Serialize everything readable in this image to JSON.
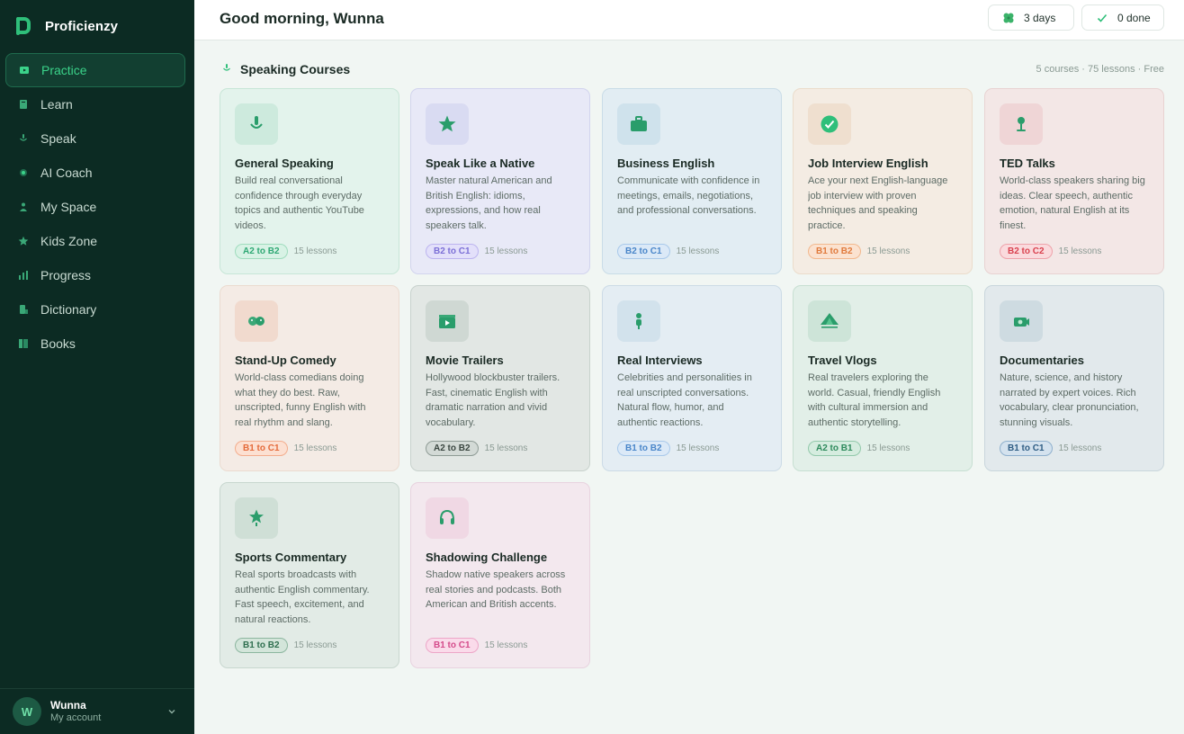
{
  "app": {
    "name": "Proficienzy"
  },
  "nav": [
    {
      "label": "Practice",
      "icon": "practice-icon",
      "active": true
    },
    {
      "label": "Learn",
      "icon": "book-icon"
    },
    {
      "label": "Speak",
      "icon": "mic-icon"
    },
    {
      "label": "AI Coach",
      "icon": "coach-icon"
    },
    {
      "label": "My Space",
      "icon": "person-icon"
    },
    {
      "label": "Kids Zone",
      "icon": "star-icon"
    },
    {
      "label": "Progress",
      "icon": "chart-icon"
    },
    {
      "label": "Dictionary",
      "icon": "dictionary-icon"
    },
    {
      "label": "Books",
      "icon": "books-icon"
    }
  ],
  "account": {
    "initial": "W",
    "name": "Wunna",
    "subtitle": "My account"
  },
  "header": {
    "greeting": "Good morning, Wunna",
    "streak": "3 days",
    "done": "0 done"
  },
  "section": {
    "title": "Speaking Courses",
    "meta": "5 courses · 75 lessons · Free"
  },
  "colors": {
    "brand": "#2fbf7a",
    "sidebar": "#0c2b23"
  },
  "courses": [
    {
      "title": "General Speaking",
      "desc": "Build real conversational confidence through everyday topics and authentic YouTube videos.",
      "level": "A2 to B2",
      "lessons": "15 lessons",
      "icon": "mic-icon"
    },
    {
      "title": "Speak Like a Native",
      "desc": "Master natural American and British English: idioms, expressions, and how real speakers talk.",
      "level": "B2 to C1",
      "lessons": "15 lessons",
      "icon": "star-icon"
    },
    {
      "title": "Business English",
      "desc": "Communicate with confidence in meetings, emails, negotiations, and professional conversations.",
      "level": "B2 to C1",
      "lessons": "15 lessons",
      "icon": "briefcase-icon"
    },
    {
      "title": "Job Interview English",
      "desc": "Ace your next English-language job interview with proven techniques and speaking practice.",
      "level": "B1 to B2",
      "lessons": "15 lessons",
      "icon": "check-circle-icon"
    },
    {
      "title": "TED Talks",
      "desc": "World-class speakers sharing big ideas. Clear speech, authentic emotion, natural English at its finest.",
      "level": "B2 to C2",
      "lessons": "15 lessons",
      "icon": "speaker-icon"
    },
    {
      "title": "Stand-Up Comedy",
      "desc": "World-class comedians doing what they do best. Raw, unscripted, funny English with real rhythm and slang.",
      "level": "B1 to C1",
      "lessons": "15 lessons",
      "icon": "comedy-icon"
    },
    {
      "title": "Movie Trailers",
      "desc": "Hollywood blockbuster trailers. Fast, cinematic English with dramatic narration and vivid vocabulary.",
      "level": "A2 to B2",
      "lessons": "15 lessons",
      "icon": "clapper-icon"
    },
    {
      "title": "Real Interviews",
      "desc": "Celebrities and personalities in real unscripted conversations. Natural flow, humor, and authentic reactions.",
      "level": "B1 to B2",
      "lessons": "15 lessons",
      "icon": "person-mic-icon"
    },
    {
      "title": "Travel Vlogs",
      "desc": "Real travelers exploring the world. Casual, friendly English with cultural immersion and authentic storytelling.",
      "level": "A2 to B1",
      "lessons": "15 lessons",
      "icon": "tent-icon"
    },
    {
      "title": "Documentaries",
      "desc": "Nature, science, and history narrated by expert voices. Rich vocabulary, clear pronunciation, stunning visuals.",
      "level": "B1 to C1",
      "lessons": "15 lessons",
      "icon": "camera-icon"
    },
    {
      "title": "Sports Commentary",
      "desc": "Real sports broadcasts with authentic English commentary. Fast speech, excitement, and natural reactions.",
      "level": "B1 to B2",
      "lessons": "15 lessons",
      "icon": "trophy-icon"
    },
    {
      "title": "Shadowing Challenge",
      "desc": "Shadow native speakers across real stories and podcasts. Both American and British accents.",
      "level": "B1 to C1",
      "lessons": "15 lessons",
      "icon": "headphones-icon"
    }
  ]
}
